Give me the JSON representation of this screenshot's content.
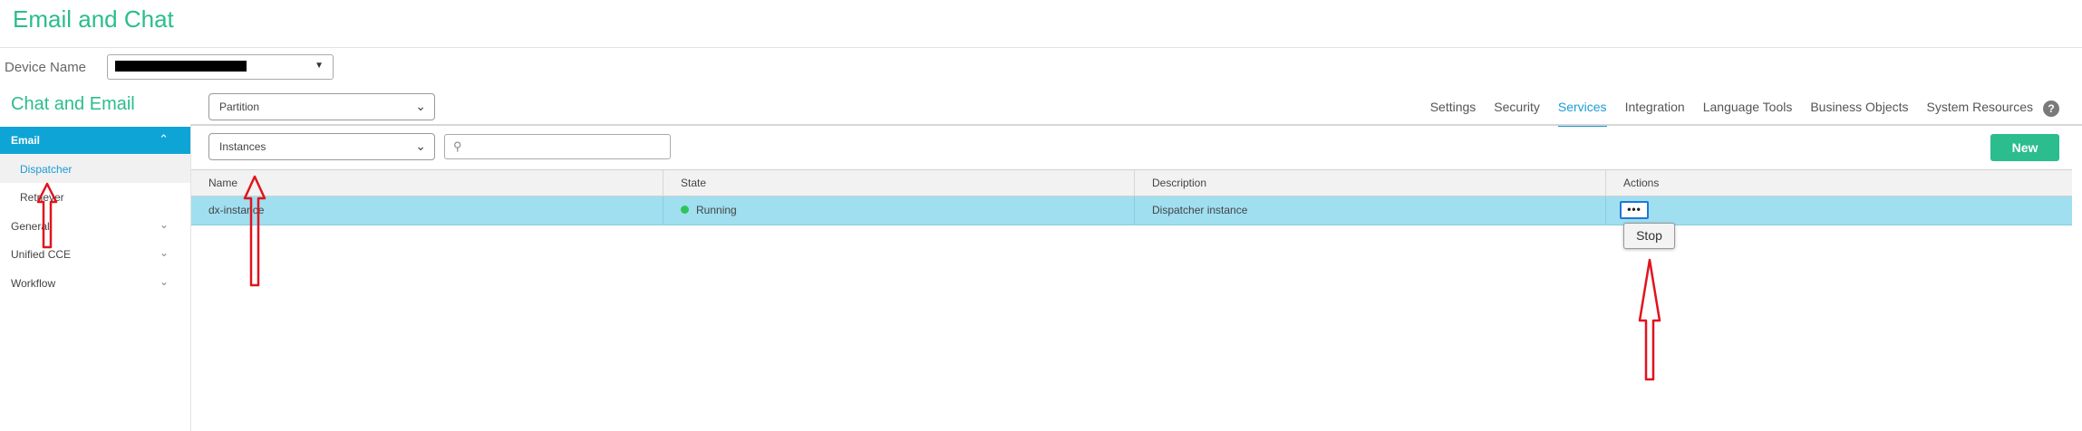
{
  "app": {
    "title": "Email and Chat"
  },
  "device": {
    "label": "Device Name",
    "value_redacted": true
  },
  "section": {
    "title": "Chat and Email"
  },
  "partition_dropdown": {
    "label": "Partition"
  },
  "instances_dropdown": {
    "label": "Instances"
  },
  "search": {
    "placeholder": "",
    "value": ""
  },
  "tabs": [
    {
      "label": "Settings",
      "active": false
    },
    {
      "label": "Security",
      "active": false
    },
    {
      "label": "Services",
      "active": true
    },
    {
      "label": "Integration",
      "active": false
    },
    {
      "label": "Language Tools",
      "active": false
    },
    {
      "label": "Business Objects",
      "active": false
    },
    {
      "label": "System Resources",
      "active": false
    }
  ],
  "help_icon": {
    "glyph": "?"
  },
  "sidebar": {
    "email": {
      "label": "Email",
      "expanded": true
    },
    "items": [
      {
        "label": "Dispatcher",
        "selected": true
      },
      {
        "label": "Retriever",
        "selected": false
      }
    ],
    "groups": [
      {
        "label": "General"
      },
      {
        "label": "Unified CCE"
      },
      {
        "label": "Workflow"
      }
    ]
  },
  "toolbar": {
    "new_label": "New"
  },
  "table": {
    "columns": [
      "Name",
      "State",
      "Description",
      "Actions"
    ],
    "rows": [
      {
        "name": "dx-instance",
        "state": "Running",
        "description": "Dispatcher instance",
        "actions_label": "•••"
      }
    ]
  },
  "actions_menu": {
    "items": [
      "Stop"
    ]
  },
  "colors": {
    "brand_green": "#2bbd8d",
    "active_blue": "#1b9bd6",
    "sidebar_active_bg": "#0ea5d6",
    "row_highlight": "#9fdff0",
    "status_running": "#2ec45c",
    "annotation_red": "#e0141e"
  }
}
